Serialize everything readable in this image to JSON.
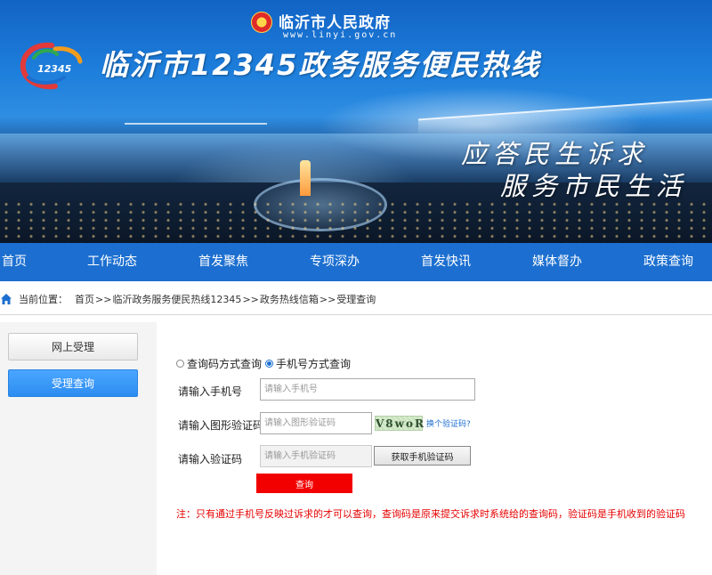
{
  "header": {
    "gov_name": "临沂市人民政府",
    "gov_url": "www.linyi.gov.cn",
    "logo_text": "12345",
    "site_title": "临沂市12345政务服务便民热线",
    "slogan_line1": "应答民生诉求",
    "slogan_line2": "服务市民生活"
  },
  "nav": {
    "items": [
      {
        "label": "首页"
      },
      {
        "label": "工作动态"
      },
      {
        "label": "首发聚焦"
      },
      {
        "label": "专项深办"
      },
      {
        "label": "首发快讯"
      },
      {
        "label": "媒体督办"
      },
      {
        "label": "政策查询"
      }
    ]
  },
  "breadcrumb": {
    "prefix": "当前位置：",
    "items": [
      "首页",
      "临沂政务服务便民热线12345",
      "政务热线信箱",
      "受理查询"
    ],
    "separator": ">>"
  },
  "sidebar": {
    "items": [
      {
        "label": "网上受理",
        "active": false
      },
      {
        "label": "受理查询",
        "active": true
      }
    ]
  },
  "form": {
    "mode_options": [
      {
        "label": "查询码方式查询",
        "checked": false
      },
      {
        "label": "手机号方式查询",
        "checked": true
      }
    ],
    "phone": {
      "label": "请输入手机号",
      "placeholder": "请输入手机号",
      "value": ""
    },
    "captcha": {
      "label": "请输入图形验证码",
      "placeholder": "请输入图形验证码",
      "value": "",
      "image_text": "V8woR",
      "refresh_link": "换个验证码?"
    },
    "sms_code": {
      "label": "请输入验证码",
      "placeholder": "请输入手机验证码",
      "value": "",
      "button": "获取手机验证码"
    },
    "submit": "查询",
    "note": "注：只有通过手机号反映过诉求的才可以查询，查询码是原来提交诉求时系统给的查询码，验证码是手机收到的验证码"
  },
  "colors": {
    "nav_bg": "#1c6fd0",
    "active_side": "#2d8cf0",
    "submit_bg": "#f20000",
    "note_text": "#e60000"
  }
}
